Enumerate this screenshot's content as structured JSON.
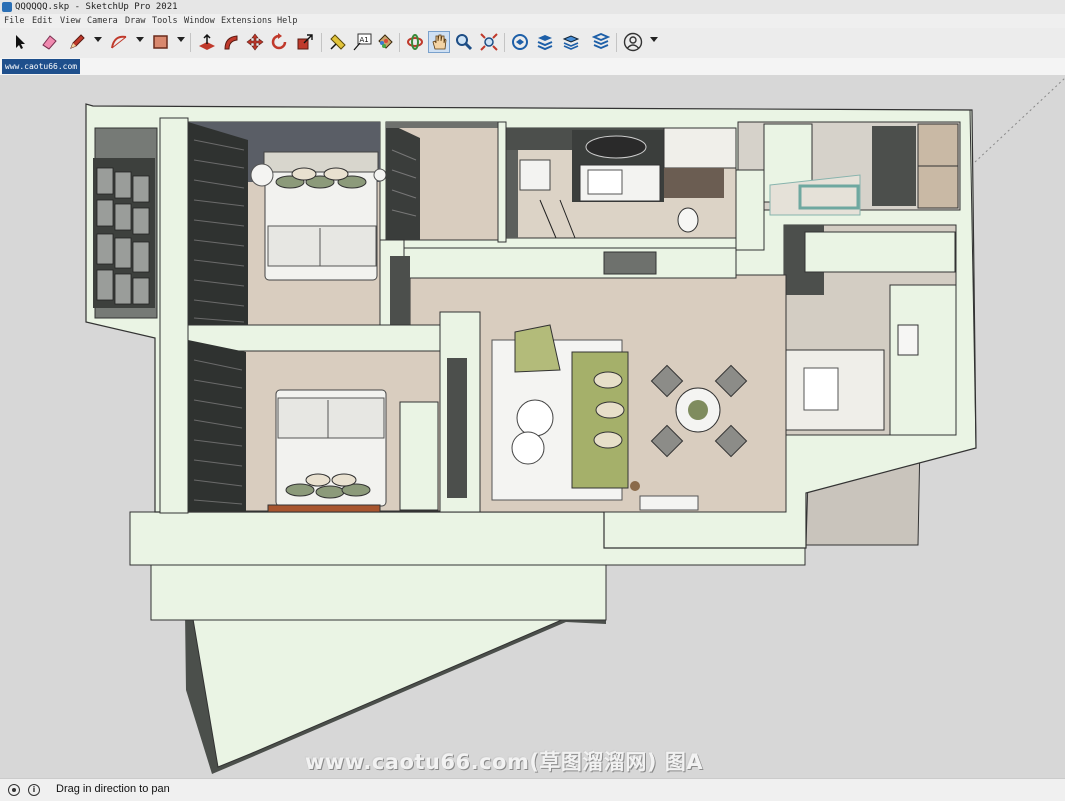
{
  "window": {
    "title": "QQQQQQ.skp - SketchUp Pro 2021"
  },
  "menu": [
    "File",
    "Edit",
    "View",
    "Camera",
    "Draw",
    "Tools",
    "Window",
    "Extensions",
    "Help"
  ],
  "toolbar": {
    "tools": [
      {
        "name": "select",
        "icon": "arrow-cursor-icon"
      },
      {
        "name": "eraser",
        "icon": "eraser-icon"
      },
      {
        "name": "line",
        "icon": "pencil-icon",
        "dropdown": true
      },
      {
        "name": "arc",
        "icon": "arc-icon",
        "dropdown": true
      },
      {
        "name": "rectangle",
        "icon": "rectangle-icon",
        "dropdown": true
      },
      {
        "name": "push-pull",
        "icon": "push-pull-icon"
      },
      {
        "name": "follow-me",
        "icon": "follow-me-icon"
      },
      {
        "name": "move",
        "icon": "move-icon"
      },
      {
        "name": "rotate",
        "icon": "rotate-icon"
      },
      {
        "name": "scale",
        "icon": "scale-icon"
      },
      {
        "name": "tape-measure",
        "icon": "tape-measure-icon"
      },
      {
        "name": "text",
        "icon": "text-icon",
        "label": "A1"
      },
      {
        "name": "paint-bucket",
        "icon": "paint-bucket-icon"
      },
      {
        "name": "orbit",
        "icon": "orbit-icon"
      },
      {
        "name": "pan",
        "icon": "hand-icon",
        "active": true
      },
      {
        "name": "zoom",
        "icon": "zoom-icon"
      },
      {
        "name": "zoom-extents",
        "icon": "zoom-extents-icon"
      },
      {
        "name": "3d-warehouse",
        "icon": "warehouse-icon"
      },
      {
        "name": "extension-warehouse",
        "icon": "extension-warehouse-icon"
      },
      {
        "name": "layout",
        "icon": "layout-icon"
      },
      {
        "name": "extension-manager",
        "icon": "extension-manager-icon"
      },
      {
        "name": "account",
        "icon": "user-icon",
        "dropdown": true
      }
    ]
  },
  "scene_tab": {
    "label": "www.caotu66.com"
  },
  "status": {
    "text": "Drag in direction to pan",
    "icons": [
      "geo-location-icon",
      "info-icon"
    ]
  },
  "watermark": {
    "text": "www.caotu66.com(草图溜溜网) 图A"
  },
  "colors": {
    "background": "#d7d7d7",
    "wall_top": "#eaf4e4",
    "wall_side": "#6e716d",
    "floor": "#d9cdbf",
    "tile": "#d6d2ca",
    "active_tool": "#cfe0f3",
    "scene_tab": "#1e4f8c"
  }
}
